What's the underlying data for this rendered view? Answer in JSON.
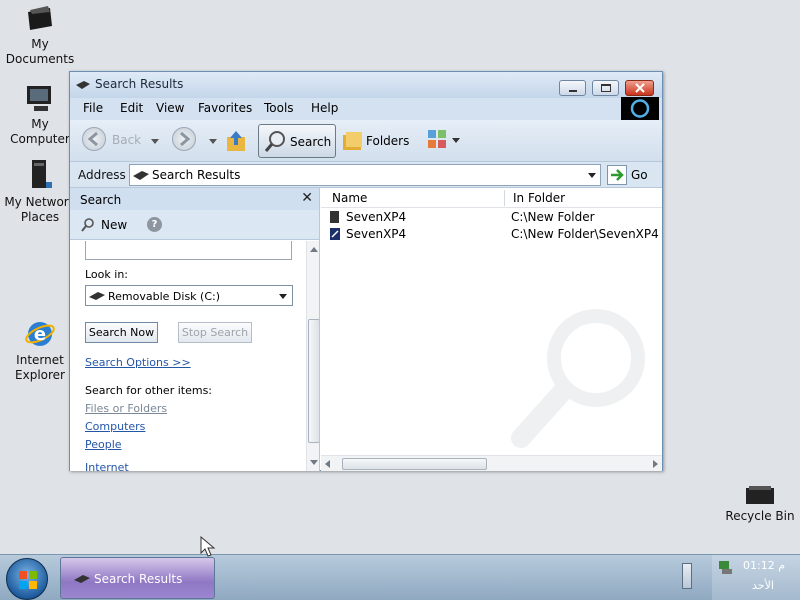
{
  "desktop": {
    "icons": [
      {
        "label": "My Documents",
        "icon": "my-documents-icon"
      },
      {
        "label": "My Computer",
        "icon": "my-computer-icon"
      },
      {
        "label": "My Network Places",
        "icon": "network-places-icon"
      },
      {
        "label": "Internet Explorer",
        "icon": "internet-explorer-icon"
      },
      {
        "label": "Recycle Bin",
        "icon": "recycle-bin-icon"
      }
    ]
  },
  "window": {
    "title": "Search Results",
    "menu": [
      "File",
      "Edit",
      "View",
      "Favorites",
      "Tools",
      "Help"
    ],
    "toolbar": {
      "back_label": "Back",
      "search_label": "Search",
      "folders_label": "Folders"
    },
    "address": {
      "label": "Address",
      "value": "Search Results",
      "go_label": "Go"
    },
    "search_pane": {
      "title": "Search",
      "new_label": "New",
      "look_in_label": "Look in:",
      "look_in_value": "Removable Disk (C:)",
      "search_now_label": "Search Now",
      "stop_search_label": "Stop Search",
      "search_options_label": "Search Options >>",
      "other_items_label": "Search for other items:",
      "links": [
        "Files or Folders",
        "Computers",
        "People",
        "Internet"
      ]
    },
    "file_list": {
      "columns": [
        "Name",
        "In Folder"
      ],
      "rows": [
        {
          "name": "SevenXP4",
          "folder": "C:\\New Folder"
        },
        {
          "name": "SevenXP4",
          "folder": "C:\\New Folder\\SevenXP4"
        }
      ]
    }
  },
  "taskbar": {
    "task_label": "Search Results",
    "clock_time": "01:12 م",
    "clock_day": "الأحد"
  },
  "colors": {
    "desktop": "#dfe3e7",
    "titlebar": "#c4d6ea",
    "pane_header": "#cfdff0",
    "link": "#2456a6"
  }
}
